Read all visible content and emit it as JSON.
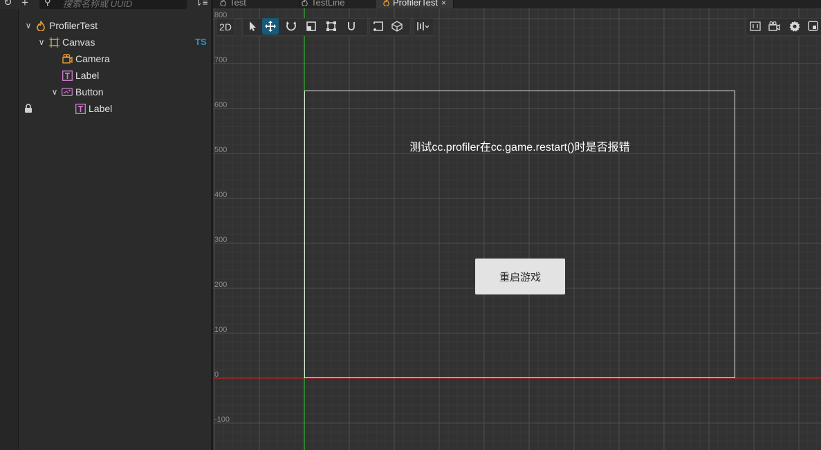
{
  "hierarchy": {
    "search_placeholder": "搜索名称或 UUID",
    "nodes": [
      {
        "label": "ProfilerTest",
        "icon": "scene-icon"
      },
      {
        "label": "Canvas",
        "icon": "canvas-icon"
      },
      {
        "label": "Camera",
        "icon": "camera-icon"
      },
      {
        "label": "Label",
        "icon": "label-icon"
      },
      {
        "label": "Button",
        "icon": "button-icon"
      },
      {
        "label": "Label",
        "icon": "label-icon"
      }
    ],
    "ts_badge": "TS"
  },
  "tabs": [
    {
      "label": "Test",
      "active": false
    },
    {
      "label": "TestLine",
      "active": false
    },
    {
      "label": "ProfilerTest",
      "active": true
    }
  ],
  "scene": {
    "mode_label": "2D",
    "ruler_labels": [
      "800",
      "700",
      "600",
      "500",
      "400",
      "300",
      "200",
      "100",
      "0",
      "-100"
    ],
    "title_text": "测试cc.profiler在cc.game.restart()时是否报错",
    "button_text": "重启游戏"
  },
  "colors": {
    "x_axis": "#c22020",
    "y_axis": "#2db82d",
    "selection": "#185a78",
    "ts_badge": "#2f8fd8"
  }
}
